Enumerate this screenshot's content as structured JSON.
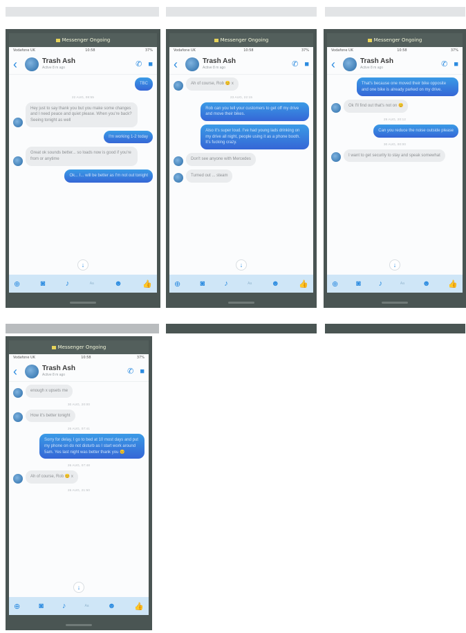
{
  "status_bar": {
    "carrier": "Vodafone UK",
    "time": "10:58",
    "battery": "37%"
  },
  "call_banner": "Messenger Ongoing",
  "contact": {
    "name": "Trash Ash",
    "sub": "Active 8 m ago"
  },
  "composer": {
    "aa": "Aa"
  },
  "panels": [
    {
      "messages": [
        {
          "type": "out",
          "text": "TBC"
        },
        {
          "type": "ts",
          "text": "22 AUG, 08:55"
        },
        {
          "type": "in",
          "text": "Hey just to say thank you but you make some changes and I need peace and quiet please. When you're back? Seeing tonight as well"
        },
        {
          "type": "out",
          "text": "I'm working 1-2 today"
        },
        {
          "type": "in",
          "text": "Great ok sounds better... so loads now is good if you're from or anytime"
        },
        {
          "type": "out",
          "text": "Ok... I... will be better as I'm not out tonight"
        }
      ]
    },
    {
      "messages": [
        {
          "type": "in",
          "text": "Ah of course, Rob 😊 x"
        },
        {
          "type": "ts",
          "text": "23 AUG, 22:15"
        },
        {
          "type": "out",
          "text": "Rob can you tell your customers to get off my drive and move their bikes."
        },
        {
          "type": "out",
          "text": "Also it's super loud. I've had young lads drinking on my drive all night, people using it as a phone booth. It's fucking crazy."
        },
        {
          "type": "in",
          "text": "Don't see anyone with Mercedes"
        },
        {
          "type": "in",
          "text": "Turned out ... steam"
        }
      ]
    },
    {
      "messages": [
        {
          "type": "out",
          "text": "That's because one moved their bike opposite and one bike is already parked on my drive."
        },
        {
          "type": "in",
          "text": "Ok I'll find out that's not on 😊"
        },
        {
          "type": "ts",
          "text": "29 AUG, 20:12"
        },
        {
          "type": "out",
          "text": "Can you reduce the noise outside please"
        },
        {
          "type": "ts",
          "text": "30 AUG, 00:00"
        },
        {
          "type": "in",
          "text": "I want to get security to stay and speak somewhat"
        }
      ]
    },
    {
      "messages": [
        {
          "type": "in",
          "text": "enough x upsets me"
        },
        {
          "type": "ts",
          "text": "30 AUG, 20:00"
        },
        {
          "type": "in",
          "text": "How it's better tonight"
        },
        {
          "type": "ts",
          "text": "26 AUG, 07:41"
        },
        {
          "type": "out",
          "text": "Sorry for delay, I go to bed at 10 most days and put my phone on do not disturb as I start work around 5am. Yes last night was better thank you 😊"
        },
        {
          "type": "ts",
          "text": "26 AUG, 07:48"
        },
        {
          "type": "in",
          "text": "Ah of course, Rob 😊 x"
        },
        {
          "type": "ts",
          "text": "26 AUG, 21:50"
        }
      ]
    }
  ]
}
